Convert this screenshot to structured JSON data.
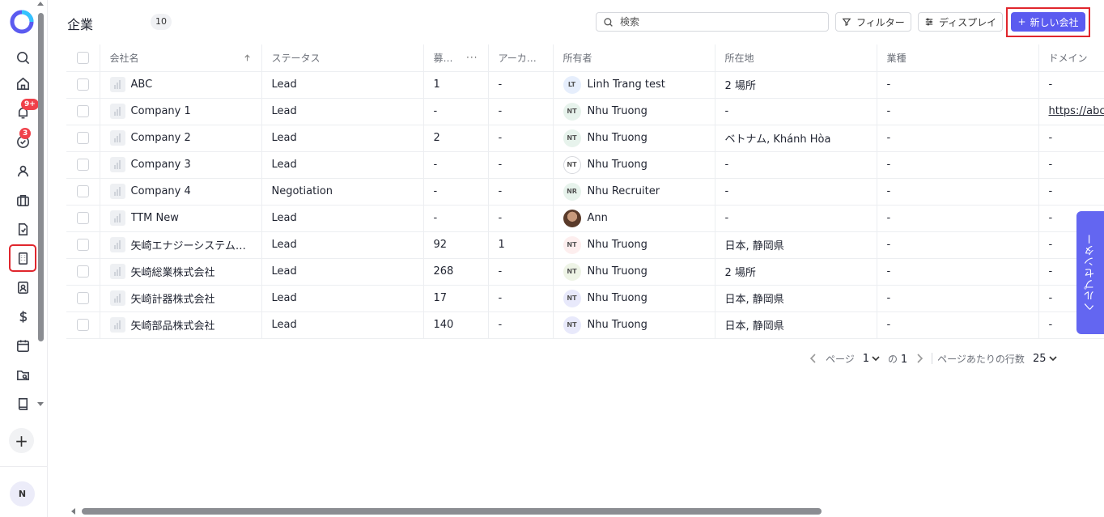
{
  "sidebar": {
    "notification_badge": "9+",
    "tasks_badge": "3",
    "user_initial": "N",
    "add_label": "+"
  },
  "header": {
    "title": "企業",
    "count": "10",
    "search_placeholder": "検索",
    "filter_label": "フィルター",
    "display_label": "ディスプレイ",
    "new_company_label": "新しい会社"
  },
  "table": {
    "columns": [
      "会社名",
      "ステータス",
      "募…",
      "アーカ…",
      "所有者",
      "所在地",
      "業種",
      "ドメイン"
    ],
    "rows": [
      {
        "name": "ABC",
        "status": "Lead",
        "col3": "1",
        "col4": "-",
        "owner_initials": "LT",
        "owner": "Linh Trang test",
        "location": "2 場所",
        "industry": "-",
        "domain": "-"
      },
      {
        "name": "Company 1",
        "status": "Lead",
        "col3": "-",
        "col4": "-",
        "owner_initials": "NT",
        "owner": "Nhu Truong",
        "location": "-",
        "industry": "-",
        "domain": "https://abc."
      },
      {
        "name": "Company 2",
        "status": "Lead",
        "col3": "2",
        "col4": "-",
        "owner_initials": "NT",
        "owner": "Nhu Truong",
        "location": "ベトナム, Khánh Hòa",
        "industry": "-",
        "domain": "-"
      },
      {
        "name": "Company 3",
        "status": "Lead",
        "col3": "-",
        "col4": "-",
        "owner_initials": "NT",
        "owner": "Nhu Truong",
        "location": "-",
        "industry": "-",
        "domain": "-"
      },
      {
        "name": "Company 4",
        "status": "Negotiation",
        "col3": "-",
        "col4": "-",
        "owner_initials": "NR",
        "owner": "Nhu Recruiter",
        "location": "-",
        "industry": "-",
        "domain": "-"
      },
      {
        "name": "TTM New",
        "status": "Lead",
        "col3": "-",
        "col4": "-",
        "owner_initials": "",
        "owner": "Ann",
        "location": "-",
        "industry": "-",
        "domain": "-"
      },
      {
        "name": "矢崎エナジーシステム株式会社",
        "status": "Lead",
        "col3": "92",
        "col4": "1",
        "owner_initials": "NT",
        "owner": "Nhu Truong",
        "location": "日本, 静岡県",
        "industry": "-",
        "domain": "-"
      },
      {
        "name": "矢崎総業株式会社",
        "status": "Lead",
        "col3": "268",
        "col4": "-",
        "owner_initials": "NT",
        "owner": "Nhu Truong",
        "location": "2 場所",
        "industry": "-",
        "domain": "-"
      },
      {
        "name": "矢崎計器株式会社",
        "status": "Lead",
        "col3": "17",
        "col4": "-",
        "owner_initials": "NT",
        "owner": "Nhu Truong",
        "location": "日本, 静岡県",
        "industry": "-",
        "domain": "-"
      },
      {
        "name": "矢崎部品株式会社",
        "status": "Lead",
        "col3": "140",
        "col4": "-",
        "owner_initials": "NT",
        "owner": "Nhu Truong",
        "location": "日本, 静岡県",
        "industry": "-",
        "domain": "-"
      }
    ]
  },
  "pagination": {
    "page_label": "ページ",
    "page": "1",
    "of_label": "の",
    "total_pages": "1",
    "rows_per_page_label": "ページあたりの行数",
    "rows_per_page": "25"
  },
  "help": {
    "label": "ヘルプセンター"
  },
  "colors": {
    "primary": "#5b5bf0",
    "highlight": "#e0262d",
    "help": "#6366f1"
  }
}
